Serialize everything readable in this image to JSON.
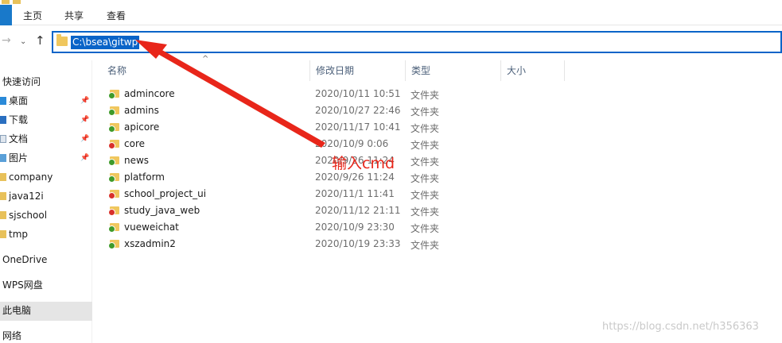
{
  "ribbon": {
    "tabs": [
      {
        "label": "主页"
      },
      {
        "label": "共享"
      },
      {
        "label": "查看"
      }
    ]
  },
  "address": {
    "path": "C:\\bsea\\gitwp"
  },
  "sidebar": {
    "quick_access": "快速访问",
    "items": [
      {
        "label": "桌面",
        "pinned": true
      },
      {
        "label": "下载",
        "pinned": true
      },
      {
        "label": "文档",
        "pinned": true
      },
      {
        "label": "图片",
        "pinned": true
      },
      {
        "label": "company"
      },
      {
        "label": "java12i"
      },
      {
        "label": "sjschool"
      },
      {
        "label": "tmp"
      }
    ],
    "onedrive": "OneDrive",
    "wps": "WPS网盘",
    "this_pc": "此电脑",
    "network": "网络"
  },
  "columns": {
    "name": "名称",
    "date": "修改日期",
    "type": "类型",
    "size": "大小"
  },
  "files": [
    {
      "name": "admincore",
      "date": "2020/10/11 10:51",
      "type": "文件夹",
      "status": "ok"
    },
    {
      "name": "admins",
      "date": "2020/10/27 22:46",
      "type": "文件夹",
      "status": "ok"
    },
    {
      "name": "apicore",
      "date": "2020/11/17 10:41",
      "type": "文件夹",
      "status": "ok"
    },
    {
      "name": "core",
      "date": "2020/10/9 0:06",
      "type": "文件夹",
      "status": "error"
    },
    {
      "name": "news",
      "date": "2020/9/26 11:24",
      "type": "文件夹",
      "status": "ok"
    },
    {
      "name": "platform",
      "date": "2020/9/26 11:24",
      "type": "文件夹",
      "status": "ok"
    },
    {
      "name": "school_project_ui",
      "date": "2020/11/1 11:41",
      "type": "文件夹",
      "status": "error"
    },
    {
      "name": "study_java_web",
      "date": "2020/11/12 21:11",
      "type": "文件夹",
      "status": "error"
    },
    {
      "name": "vueweichat",
      "date": "2020/10/9 23:30",
      "type": "文件夹",
      "status": "ok"
    },
    {
      "name": "xszadmin2",
      "date": "2020/10/19 23:33",
      "type": "文件夹",
      "status": "ok"
    }
  ],
  "annotation": {
    "text": "输入cmd",
    "color": "#e8261a"
  },
  "watermark": "https://blog.csdn.net/h356363",
  "colors": {
    "accent": "#0a64c8",
    "folder": "#f0c75e",
    "status_ok": "#3f9a2a",
    "status_error": "#d8312a"
  }
}
